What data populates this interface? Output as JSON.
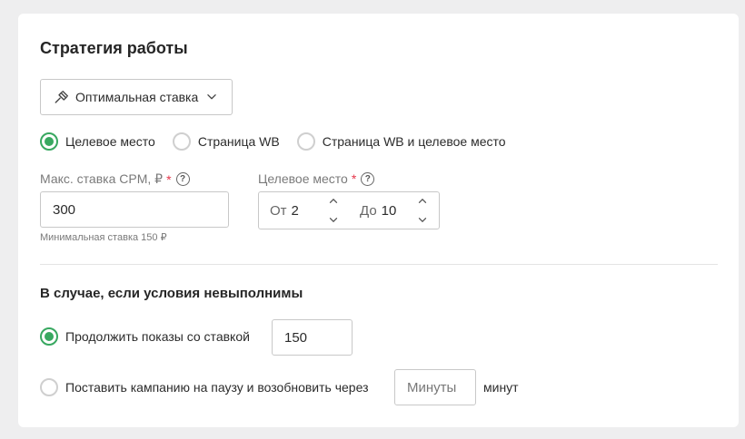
{
  "strategy": {
    "title": "Стратегия работы",
    "mode_button": {
      "label": "Оптимальная ставка",
      "icon": "gavel-icon",
      "dropdown_icon": "chevron-down-icon"
    },
    "placement_options": [
      {
        "label": "Целевое место",
        "selected": true
      },
      {
        "label": "Страница WB",
        "selected": false
      },
      {
        "label": "Страница WB и целевое место",
        "selected": false
      }
    ],
    "max_bid": {
      "label": "Макс. ставка CPM, ₽",
      "required_mark": "*",
      "help": "?",
      "value": "300",
      "hint": "Минимальная ставка 150 ₽"
    },
    "target_place": {
      "label": "Целевое место",
      "required_mark": "*",
      "help": "?",
      "from_prefix": "От",
      "from_value": "2",
      "to_prefix": "До",
      "to_value": "10"
    }
  },
  "fallback": {
    "title": "В случае, если условия невыполнимы",
    "continue_option": {
      "label": "Продолжить показы со ставкой",
      "selected": true,
      "bid_value": "150"
    },
    "pause_option": {
      "label": "Поставить кампанию на паузу и возобновить через",
      "selected": false,
      "minutes_placeholder": "Минуты",
      "unit": "минут"
    }
  },
  "colors": {
    "accent": "#38a860",
    "required": "#e5364b",
    "background": "#eeeeef",
    "card": "#ffffff"
  }
}
